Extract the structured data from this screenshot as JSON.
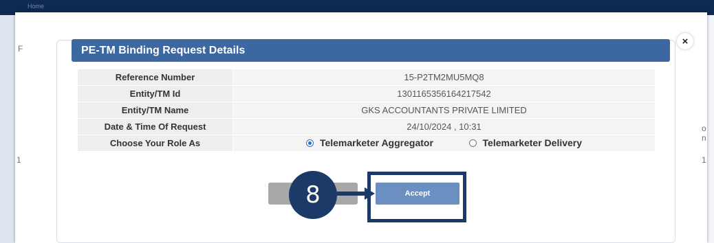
{
  "background": {
    "top_fragment": "Home"
  },
  "page_fragments": [
    "F",
    "1",
    "1",
    "o",
    "n"
  ],
  "dialog": {
    "title": "PE-TM Binding Request Details",
    "close_label": "×",
    "rows": [
      {
        "label": "Reference Number",
        "value": "15-P2TM2MU5MQ8"
      },
      {
        "label": "Entity/TM Id",
        "value": "1301165356164217542"
      },
      {
        "label": "Entity/TM Name",
        "value": "GKS ACCOUNTANTS PRIVATE LIMITED"
      },
      {
        "label": "Date & Time Of Request",
        "value": "24/10/2024 , 10:31"
      }
    ],
    "role": {
      "label": "Choose Your Role As",
      "options": [
        {
          "label": "Telemarketer Aggregator",
          "selected": true
        },
        {
          "label": "Telemarketer Delivery",
          "selected": false
        }
      ]
    },
    "accept_label": "Accept",
    "cancel_label": ""
  },
  "annotation": {
    "step": "8",
    "color": "#1b3a68"
  },
  "colors": {
    "header": "#3d67a0",
    "accept": "#6a8fc0",
    "radio": "#2f6fd1"
  }
}
